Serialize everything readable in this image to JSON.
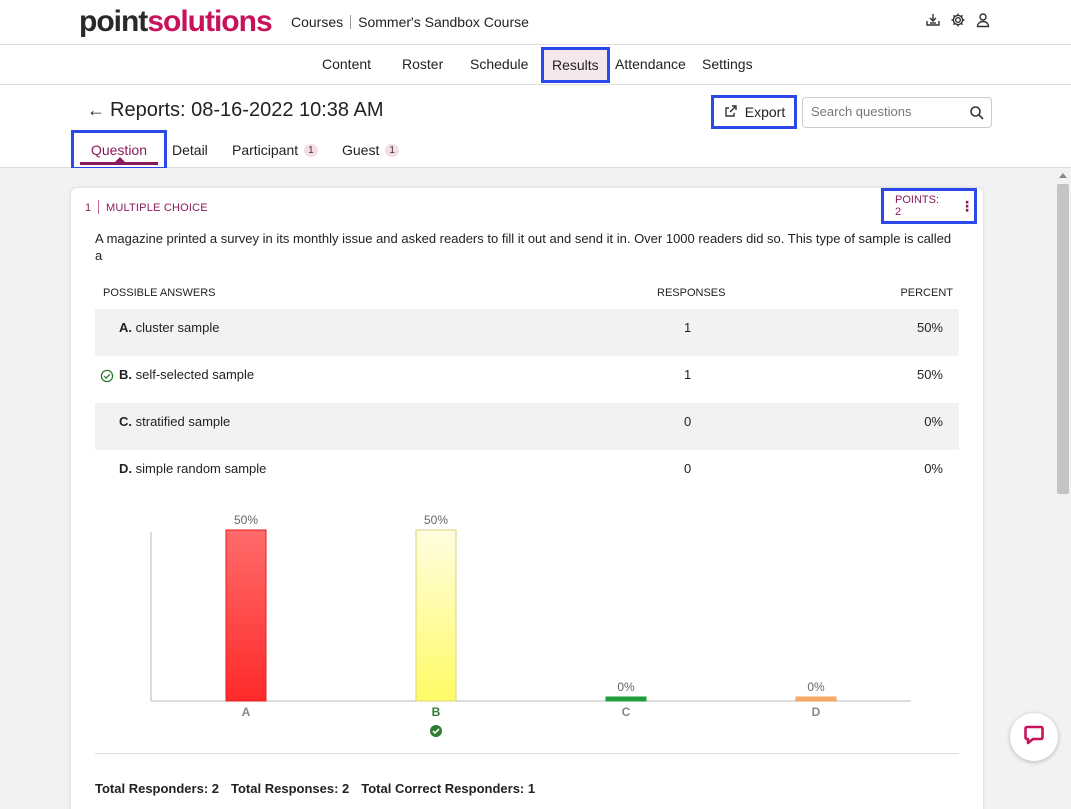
{
  "header": {
    "logo_part1": "point",
    "logo_part2": "solutions",
    "breadcrumb_courses": "Courses",
    "breadcrumb_course": "Sommer's Sandbox Course",
    "icons": [
      "download-icon",
      "gear-icon",
      "user-icon"
    ]
  },
  "nav": {
    "items": [
      "Content",
      "Roster",
      "Schedule",
      "Results",
      "Attendance",
      "Settings"
    ],
    "active": "Results"
  },
  "report": {
    "title": "Reports: 08-16-2022 10:38 AM",
    "export_label": "Export",
    "search_placeholder": "Search questions"
  },
  "tabs": [
    {
      "label": "Question",
      "badge": ""
    },
    {
      "label": "Detail",
      "badge": ""
    },
    {
      "label": "Participant",
      "badge": "1"
    },
    {
      "label": "Guest",
      "badge": "1"
    }
  ],
  "question": {
    "number": "1",
    "type": "MULTIPLE CHOICE",
    "points_label": "POINTS: 2",
    "text": "A magazine printed a survey in its monthly issue and asked readers to fill it out and send it in. Over 1000 readers did so. This type of sample is called a",
    "columns": {
      "answers": "POSSIBLE ANSWERS",
      "responses": "RESPONSES",
      "percent": "PERCENT"
    },
    "answers": [
      {
        "letter": "A.",
        "text": "cluster sample",
        "responses": "1",
        "percent": "50%",
        "correct": false
      },
      {
        "letter": "B.",
        "text": "self-selected sample",
        "responses": "1",
        "percent": "50%",
        "correct": true
      },
      {
        "letter": "C.",
        "text": "stratified sample",
        "responses": "0",
        "percent": "0%",
        "correct": false
      },
      {
        "letter": "D.",
        "text": "simple random sample",
        "responses": "0",
        "percent": "0%",
        "correct": false
      }
    ],
    "totals": {
      "responders": "Total Responders: 2",
      "responses": "Total Responses: 2",
      "correct": "Total Correct Responders: 1"
    }
  },
  "colors": {
    "brand": "#c8135c",
    "accent": "#8b1a5c",
    "highlight": "#2a49e8",
    "correct": "#2e7d32"
  },
  "chart_data": {
    "type": "bar",
    "categories": [
      "A",
      "B",
      "C",
      "D"
    ],
    "values": [
      50,
      50,
      0,
      0
    ],
    "value_labels": [
      "50%",
      "50%",
      "0%",
      "0%"
    ],
    "colors": [
      "#ff2a2a",
      "#fffb66",
      "#1e9e3a",
      "#f5a05a"
    ],
    "correct_category": "B",
    "ylim": [
      0,
      50
    ],
    "grid": false
  }
}
